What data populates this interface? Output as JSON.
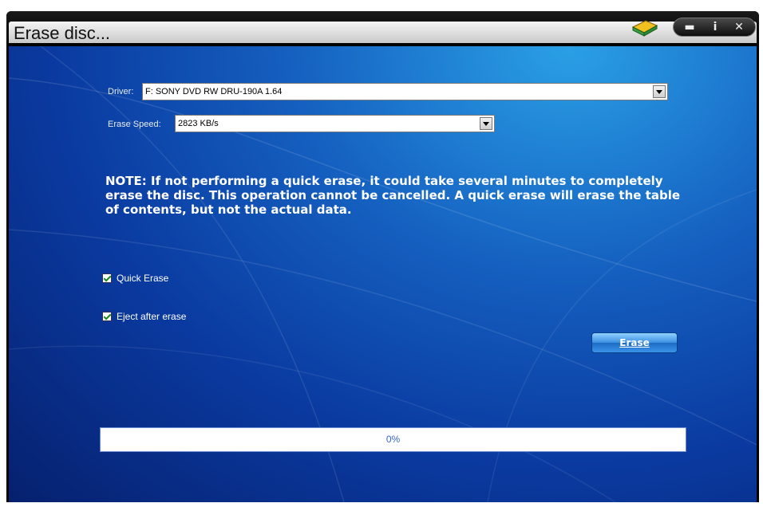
{
  "window": {
    "title": "Erase disc...",
    "buttons": {
      "minimize": "▬",
      "info": "i",
      "close": "✕"
    }
  },
  "form": {
    "driver": {
      "label": "Driver:",
      "value": "F: SONY DVD RW DRU-190A 1.64"
    },
    "erase_speed": {
      "label": "Erase Speed:",
      "value": "2823 KB/s"
    },
    "note": "NOTE: If not performing a quick erase, it could take several minutes to completely erase the disc. This operation cannot be cancelled. A quick erase will erase the table of contents, but not the actual data.",
    "options": [
      {
        "label": "Quick Erase",
        "checked": true
      },
      {
        "label": "Eject after erase",
        "checked": true
      }
    ],
    "erase_button": "Erase"
  },
  "progress": {
    "text": "0%",
    "fraction": 0
  },
  "colors": {
    "accent": "#1560c0",
    "background_dark": "#06206e",
    "progress_text": "#3a64c8"
  },
  "icons": [
    "book-icon",
    "minimize-icon",
    "info-icon",
    "close-icon",
    "chevron-down-icon",
    "checkbox-icon"
  ]
}
